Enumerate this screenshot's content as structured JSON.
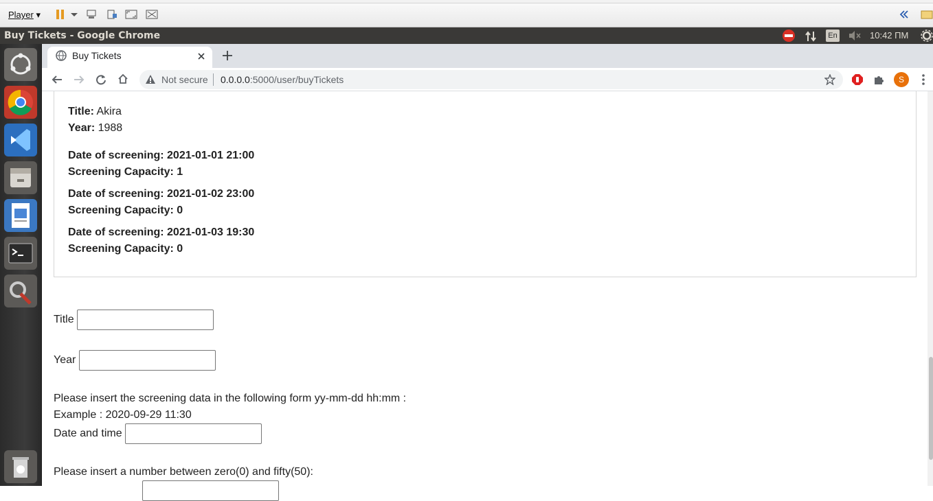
{
  "vm": {
    "menu_label": "Player"
  },
  "panel": {
    "window_title": "Buy Tickets - Google Chrome",
    "lang": "En",
    "clock": "10:42 ПМ"
  },
  "browser": {
    "tab_title": "Buy Tickets",
    "security_label": "Not secure",
    "url_host": "0.0.0.0",
    "url_rest": ":5000/user/buyTickets",
    "profile_initial": "S"
  },
  "movie": {
    "title_label": "Title:",
    "title_value": "Akira",
    "year_label": "Year:",
    "year_value": "1988",
    "screenings": [
      {
        "date": "Date of screening: 2021-01-01 21:00",
        "capacity": "Screening Capacity: 1"
      },
      {
        "date": "Date of screening: 2021-01-02 23:00",
        "capacity": "Screening Capacity: 0"
      },
      {
        "date": "Date of screening: 2021-01-03 19:30",
        "capacity": "Screening Capacity: 0"
      }
    ]
  },
  "form": {
    "title_label": "Title",
    "year_label": "Year",
    "instructions": "Please insert the screening data in the following form yy-mm-dd hh:mm :",
    "example": "Example : 2020-09-29 11:30",
    "datetime_label": "Date and time",
    "number_prompt": "Please insert a number between zero(0) and fifty(50):"
  },
  "colors": {
    "panel_bg": "#3a3937",
    "tabstrip_bg": "#dee1e6",
    "profile_bg": "#e8710a",
    "adblock_red": "#e02020"
  }
}
